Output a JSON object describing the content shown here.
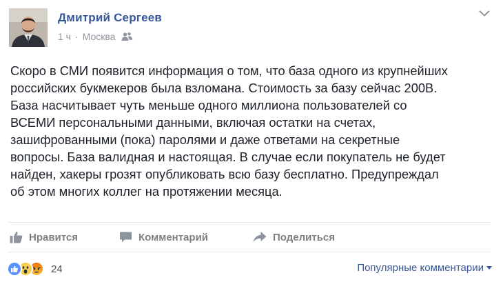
{
  "post": {
    "author": "Дмитрий Сергеев",
    "time": "1 ч",
    "separator": "·",
    "location": "Москва",
    "privacy_icon": "people-icon",
    "menu_icon": "chevron-down-icon",
    "text_lines": [
      "Скоро в СМИ появится информация о том, что база одного из крупнейших",
      "российских букмекеров была взломана. Стоимость за базу сейчас 200В.",
      "База насчитывает чуть меньше одного миллиона пользователей со",
      "ВСЕМИ персональными данными, включая остатки на счетах,",
      "зашифрованными (пока) паролями и даже ответами на секретные",
      "вопросы. База валидная и настоящая. В случае если покупатель не будет",
      "найден, хакеры грозят опубликовать всю базу бесплатно. Предупреждал",
      "об этом многих коллег на протяжении месяца."
    ]
  },
  "actions": {
    "like": "Нравится",
    "comment": "Комментарий",
    "share": "Поделиться"
  },
  "reactions": {
    "types": [
      "like-icon",
      "wow-icon",
      "angry-icon"
    ],
    "count": "24"
  },
  "comments_sort": {
    "label": "Популярные комментарии"
  },
  "colors": {
    "link": "#365899",
    "muted": "#90949c",
    "action": "#7f7f7f",
    "like_blue": "#5890ff",
    "wow_yellow": "#f7cb4d",
    "angry_orange": "#e9710f"
  }
}
